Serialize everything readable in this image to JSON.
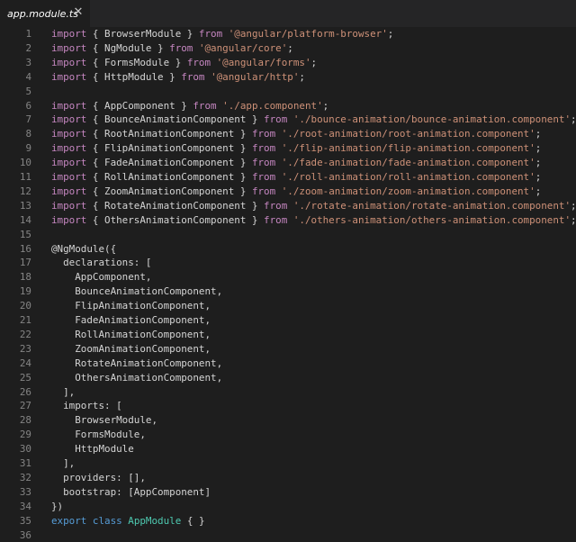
{
  "tab": {
    "title": "app.module.ts",
    "close_glyph": "✕"
  },
  "lines": [
    {
      "n": "1",
      "tokens": [
        {
          "c": "k",
          "t": "import"
        },
        {
          "c": "p",
          "t": " { BrowserModule } "
        },
        {
          "c": "k",
          "t": "from"
        },
        {
          "c": "p",
          "t": " "
        },
        {
          "c": "s",
          "t": "'@angular/platform-browser'"
        },
        {
          "c": "p",
          "t": ";"
        }
      ]
    },
    {
      "n": "2",
      "tokens": [
        {
          "c": "k",
          "t": "import"
        },
        {
          "c": "p",
          "t": " { NgModule } "
        },
        {
          "c": "k",
          "t": "from"
        },
        {
          "c": "p",
          "t": " "
        },
        {
          "c": "s",
          "t": "'@angular/core'"
        },
        {
          "c": "p",
          "t": ";"
        }
      ]
    },
    {
      "n": "3",
      "tokens": [
        {
          "c": "k",
          "t": "import"
        },
        {
          "c": "p",
          "t": " { FormsModule } "
        },
        {
          "c": "k",
          "t": "from"
        },
        {
          "c": "p",
          "t": " "
        },
        {
          "c": "s",
          "t": "'@angular/forms'"
        },
        {
          "c": "p",
          "t": ";"
        }
      ]
    },
    {
      "n": "4",
      "tokens": [
        {
          "c": "k",
          "t": "import"
        },
        {
          "c": "p",
          "t": " { HttpModule } "
        },
        {
          "c": "k",
          "t": "from"
        },
        {
          "c": "p",
          "t": " "
        },
        {
          "c": "s",
          "t": "'@angular/http'"
        },
        {
          "c": "p",
          "t": ";"
        }
      ]
    },
    {
      "n": "5",
      "tokens": []
    },
    {
      "n": "6",
      "tokens": [
        {
          "c": "k",
          "t": "import"
        },
        {
          "c": "p",
          "t": " { AppComponent } "
        },
        {
          "c": "k",
          "t": "from"
        },
        {
          "c": "p",
          "t": " "
        },
        {
          "c": "s",
          "t": "'./app.component'"
        },
        {
          "c": "p",
          "t": ";"
        }
      ]
    },
    {
      "n": "7",
      "tokens": [
        {
          "c": "k",
          "t": "import"
        },
        {
          "c": "p",
          "t": " { BounceAnimationComponent } "
        },
        {
          "c": "k",
          "t": "from"
        },
        {
          "c": "p",
          "t": " "
        },
        {
          "c": "s",
          "t": "'./bounce-animation/bounce-animation.component'"
        },
        {
          "c": "p",
          "t": ";"
        }
      ]
    },
    {
      "n": "8",
      "tokens": [
        {
          "c": "k",
          "t": "import"
        },
        {
          "c": "p",
          "t": " { RootAnimationComponent } "
        },
        {
          "c": "k",
          "t": "from"
        },
        {
          "c": "p",
          "t": " "
        },
        {
          "c": "s",
          "t": "'./root-animation/root-animation.component'"
        },
        {
          "c": "p",
          "t": ";"
        }
      ]
    },
    {
      "n": "9",
      "tokens": [
        {
          "c": "k",
          "t": "import"
        },
        {
          "c": "p",
          "t": " { FlipAnimationComponent } "
        },
        {
          "c": "k",
          "t": "from"
        },
        {
          "c": "p",
          "t": " "
        },
        {
          "c": "s",
          "t": "'./flip-animation/flip-animation.component'"
        },
        {
          "c": "p",
          "t": ";"
        }
      ]
    },
    {
      "n": "10",
      "tokens": [
        {
          "c": "k",
          "t": "import"
        },
        {
          "c": "p",
          "t": " { FadeAnimationComponent } "
        },
        {
          "c": "k",
          "t": "from"
        },
        {
          "c": "p",
          "t": " "
        },
        {
          "c": "s",
          "t": "'./fade-animation/fade-animation.component'"
        },
        {
          "c": "p",
          "t": ";"
        }
      ]
    },
    {
      "n": "11",
      "tokens": [
        {
          "c": "k",
          "t": "import"
        },
        {
          "c": "p",
          "t": " { RollAnimationComponent } "
        },
        {
          "c": "k",
          "t": "from"
        },
        {
          "c": "p",
          "t": " "
        },
        {
          "c": "s",
          "t": "'./roll-animation/roll-animation.component'"
        },
        {
          "c": "p",
          "t": ";"
        }
      ]
    },
    {
      "n": "12",
      "tokens": [
        {
          "c": "k",
          "t": "import"
        },
        {
          "c": "p",
          "t": " { ZoomAnimationComponent } "
        },
        {
          "c": "k",
          "t": "from"
        },
        {
          "c": "p",
          "t": " "
        },
        {
          "c": "s",
          "t": "'./zoom-animation/zoom-animation.component'"
        },
        {
          "c": "p",
          "t": ";"
        }
      ]
    },
    {
      "n": "13",
      "tokens": [
        {
          "c": "k",
          "t": "import"
        },
        {
          "c": "p",
          "t": " { RotateAnimationComponent } "
        },
        {
          "c": "k",
          "t": "from"
        },
        {
          "c": "p",
          "t": " "
        },
        {
          "c": "s",
          "t": "'./rotate-animation/rotate-animation.component'"
        },
        {
          "c": "p",
          "t": ";"
        }
      ]
    },
    {
      "n": "14",
      "tokens": [
        {
          "c": "k",
          "t": "import"
        },
        {
          "c": "p",
          "t": " { OthersAnimationComponent } "
        },
        {
          "c": "k",
          "t": "from"
        },
        {
          "c": "p",
          "t": " "
        },
        {
          "c": "s",
          "t": "'./others-animation/others-animation.component'"
        },
        {
          "c": "p",
          "t": ";"
        }
      ]
    },
    {
      "n": "15",
      "tokens": []
    },
    {
      "n": "16",
      "tokens": [
        {
          "c": "p",
          "t": "@NgModule({"
        }
      ]
    },
    {
      "n": "17",
      "tokens": [
        {
          "c": "p",
          "t": "  declarations: ["
        }
      ]
    },
    {
      "n": "18",
      "tokens": [
        {
          "c": "p",
          "t": "    AppComponent,"
        }
      ]
    },
    {
      "n": "19",
      "tokens": [
        {
          "c": "p",
          "t": "    BounceAnimationComponent,"
        }
      ]
    },
    {
      "n": "20",
      "tokens": [
        {
          "c": "p",
          "t": "    FlipAnimationComponent,"
        }
      ]
    },
    {
      "n": "21",
      "tokens": [
        {
          "c": "p",
          "t": "    FadeAnimationComponent,"
        }
      ]
    },
    {
      "n": "22",
      "tokens": [
        {
          "c": "p",
          "t": "    RollAnimationComponent,"
        }
      ]
    },
    {
      "n": "23",
      "tokens": [
        {
          "c": "p",
          "t": "    ZoomAnimationComponent,"
        }
      ]
    },
    {
      "n": "24",
      "tokens": [
        {
          "c": "p",
          "t": "    RotateAnimationComponent,"
        }
      ]
    },
    {
      "n": "25",
      "tokens": [
        {
          "c": "p",
          "t": "    OthersAnimationComponent,"
        }
      ]
    },
    {
      "n": "26",
      "tokens": [
        {
          "c": "p",
          "t": "  ],"
        }
      ]
    },
    {
      "n": "27",
      "tokens": [
        {
          "c": "p",
          "t": "  imports: ["
        }
      ]
    },
    {
      "n": "28",
      "tokens": [
        {
          "c": "p",
          "t": "    BrowserModule,"
        }
      ]
    },
    {
      "n": "29",
      "tokens": [
        {
          "c": "p",
          "t": "    FormsModule,"
        }
      ]
    },
    {
      "n": "30",
      "tokens": [
        {
          "c": "p",
          "t": "    HttpModule"
        }
      ]
    },
    {
      "n": "31",
      "tokens": [
        {
          "c": "p",
          "t": "  ],"
        }
      ]
    },
    {
      "n": "32",
      "tokens": [
        {
          "c": "p",
          "t": "  providers: [],"
        }
      ]
    },
    {
      "n": "33",
      "tokens": [
        {
          "c": "p",
          "t": "  bootstrap: [AppComponent]"
        }
      ]
    },
    {
      "n": "34",
      "tokens": [
        {
          "c": "p",
          "t": "})"
        }
      ]
    },
    {
      "n": "35",
      "tokens": [
        {
          "c": "kb",
          "t": "export"
        },
        {
          "c": "p",
          "t": " "
        },
        {
          "c": "kb",
          "t": "class"
        },
        {
          "c": "p",
          "t": " "
        },
        {
          "c": "t",
          "t": "AppModule"
        },
        {
          "c": "p",
          "t": " { }"
        }
      ]
    },
    {
      "n": "36",
      "tokens": []
    }
  ],
  "colors": {
    "background": "#1e1e1e",
    "tabbar": "#252526",
    "keyword_import": "#c586c0",
    "keyword_export": "#569cd6",
    "string": "#ce9178",
    "type": "#4ec9b0",
    "plain": "#d4d4d4",
    "line_number": "#858585"
  }
}
